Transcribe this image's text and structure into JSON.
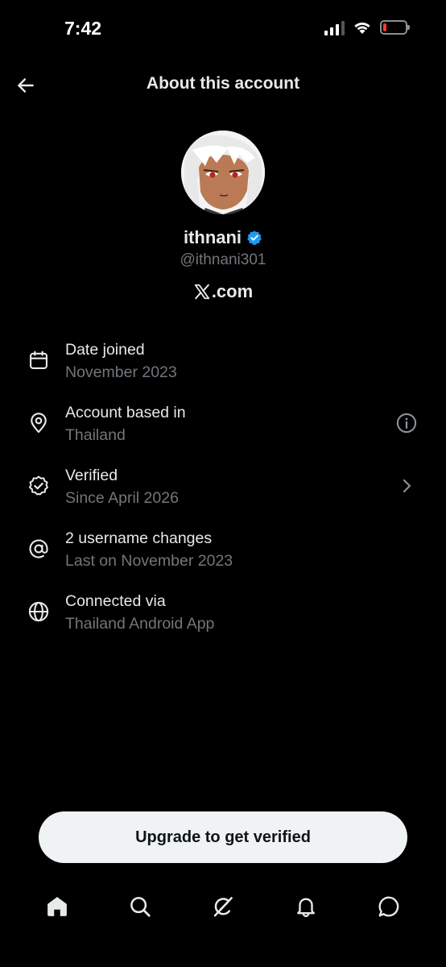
{
  "status_bar": {
    "time": "7:42",
    "battery_level": 0.15,
    "battery_color": "#ff3b30"
  },
  "header": {
    "title": "About this account",
    "back_icon": "arrow-left-icon"
  },
  "profile": {
    "display_name": "ithnani",
    "verified_badge_color": "#1d9bf0",
    "handle": "@ithnani301",
    "source_text": ".com",
    "source_logo": "x-logo-icon"
  },
  "details": [
    {
      "icon": "calendar-icon",
      "title": "Date joined",
      "subtitle": "November 2023",
      "action": ""
    },
    {
      "icon": "location-pin-icon",
      "title": "Account based in",
      "subtitle": "Thailand",
      "action": "info-icon"
    },
    {
      "icon": "verified-badge-icon",
      "title": "Verified",
      "subtitle": "Since April 2026",
      "action": "chevron-right-icon"
    },
    {
      "icon": "at-sign-icon",
      "title": "2 username changes",
      "subtitle": "Last on November 2023",
      "action": ""
    },
    {
      "icon": "globe-icon",
      "title": "Connected via",
      "subtitle": "Thailand Android App",
      "action": ""
    }
  ],
  "upgrade_button": {
    "label": "Upgrade to get verified"
  },
  "bottom_nav": [
    {
      "icon": "home-icon",
      "active": true
    },
    {
      "icon": "search-icon",
      "active": false
    },
    {
      "icon": "grok-icon",
      "active": false
    },
    {
      "icon": "bell-icon",
      "active": false
    },
    {
      "icon": "messages-icon",
      "active": false
    }
  ],
  "colors": {
    "background": "#000000",
    "primary_text": "#e7e9ea",
    "secondary_text": "#71767b",
    "button_bg": "#eff3f4"
  }
}
